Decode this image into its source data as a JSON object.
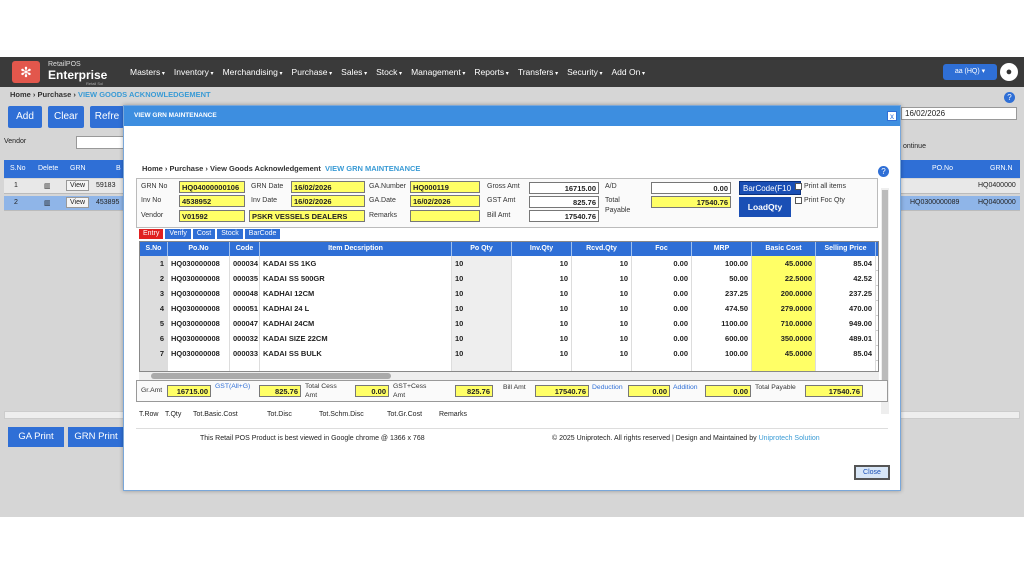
{
  "app": {
    "brand_small": "RetailPOS",
    "brand_big": "Enterprise",
    "brand_sub": "Retail Sol",
    "menu": [
      "Masters",
      "Inventory",
      "Merchandising",
      "Purchase",
      "Sales",
      "Stock",
      "Management",
      "Reports",
      "Transfers",
      "Security",
      "Add On"
    ],
    "user": "aa (HQ)"
  },
  "breadcrumb": {
    "home": "Home",
    "purchase": "Purchase",
    "current": "VIEW GOODS ACKNOWLEDGEMENT"
  },
  "bg": {
    "buttons": [
      "Add",
      "Clear",
      "Refre"
    ],
    "date": "16/02/2026",
    "vendor_label": "Vendor",
    "continue": "ontinue",
    "headers": [
      "S.No",
      "Delete",
      "GRN",
      "B",
      "PO.No",
      "GRN.N"
    ],
    "rows": [
      {
        "sno": "1",
        "view": "View",
        "num": "59183",
        "po": "",
        "grn": "HQ0400000"
      },
      {
        "sno": "2",
        "view": "View",
        "num": "453895",
        "po": "HQ0300000089",
        "grn": "HQ0400000"
      }
    ],
    "print_buttons": [
      "GA Print",
      "GRN Print"
    ]
  },
  "modal": {
    "title": "VIEW GRN MAINTENANCE",
    "close_x": "x",
    "crumb": {
      "home": "Home",
      "purchase": "Purchase",
      "mid": "View Goods Acknowledgement",
      "current": "VIEW GRN MAINTENANCE"
    },
    "form": {
      "grn_no_label": "GRN No",
      "grn_no": "HQ04000000106",
      "inv_no_label": "Inv No",
      "inv_no": "4538952",
      "vendor_label": "Vendor",
      "vendor": "V01592",
      "grn_date_label": "GRN Date",
      "grn_date": "16/02/2026",
      "inv_date_label": "Inv Date",
      "inv_date": "16/02/2026",
      "vendor_name": "PSKR VESSELS DEALERS",
      "ga_number_label": "GA.Number",
      "ga_number": "HQ000119",
      "ga_date_label": "GA.Date",
      "ga_date": "16/02/2026",
      "remarks_label": "Remarks",
      "remarks": "",
      "gross_amt_label": "Gross Amt",
      "gross_amt": "16715.00",
      "gst_amt_label": "GST Amt",
      "gst_amt": "825.76",
      "bill_amt_label": "Bill Amt",
      "bill_amt": "17540.76",
      "ad_label": "A/D",
      "ad": "0.00",
      "total_payable_label_1": "Total",
      "total_payable_label_2": "Payable",
      "total_payable": "17540.76",
      "barcode_btn": "BarCode(F10",
      "loadqty_btn": "LoadQty",
      "print_all": "Print all items",
      "print_foc": "Print Foc Qty"
    },
    "tabs": [
      {
        "label": "Entry",
        "color": "#e02020"
      },
      {
        "label": "Verify",
        "color": "#2f6fd6"
      },
      {
        "label": "Cost",
        "color": "#2f6fd6"
      },
      {
        "label": "Stock",
        "color": "#2f6fd6"
      },
      {
        "label": "BarCode",
        "color": "#2f6fd6"
      }
    ],
    "grid": {
      "headers": [
        "S.No",
        "Po.No",
        "Code",
        "Item Decsription",
        "Po Qty",
        "Inv.Qty",
        "Rcvd.Qty",
        "Foc",
        "MRP",
        "Basic Cost",
        "Selling Price"
      ],
      "rows": [
        {
          "sno": "1",
          "po": "HQ030000008",
          "code": "000034",
          "desc": "KADAI SS 1KG",
          "poqty": "10",
          "invqty": "10",
          "rcvd": "10",
          "foc": "0.00",
          "mrp": "100.00",
          "cost": "45.0000",
          "sp": "85.04"
        },
        {
          "sno": "2",
          "po": "HQ030000008",
          "code": "000035",
          "desc": "KADAI SS 500GR",
          "poqty": "10",
          "invqty": "10",
          "rcvd": "10",
          "foc": "0.00",
          "mrp": "50.00",
          "cost": "22.5000",
          "sp": "42.52"
        },
        {
          "sno": "3",
          "po": "HQ030000008",
          "code": "000048",
          "desc": "KADHAI 12CM",
          "poqty": "10",
          "invqty": "10",
          "rcvd": "10",
          "foc": "0.00",
          "mrp": "237.25",
          "cost": "200.0000",
          "sp": "237.25"
        },
        {
          "sno": "4",
          "po": "HQ030000008",
          "code": "000051",
          "desc": "KADHAI 24 L",
          "poqty": "10",
          "invqty": "10",
          "rcvd": "10",
          "foc": "0.00",
          "mrp": "474.50",
          "cost": "279.0000",
          "sp": "470.00"
        },
        {
          "sno": "5",
          "po": "HQ030000008",
          "code": "000047",
          "desc": "KADHAI 24CM",
          "poqty": "10",
          "invqty": "10",
          "rcvd": "10",
          "foc": "0.00",
          "mrp": "1100.00",
          "cost": "710.0000",
          "sp": "949.00"
        },
        {
          "sno": "6",
          "po": "HQ030000008",
          "code": "000032",
          "desc": "KADAI SIZE 22CM",
          "poqty": "10",
          "invqty": "10",
          "rcvd": "10",
          "foc": "0.00",
          "mrp": "600.00",
          "cost": "350.0000",
          "sp": "489.01"
        },
        {
          "sno": "7",
          "po": "HQ030000008",
          "code": "000033",
          "desc": "KADAI SS BULK",
          "poqty": "10",
          "invqty": "10",
          "rcvd": "10",
          "foc": "0.00",
          "mrp": "100.00",
          "cost": "45.0000",
          "sp": "85.04"
        }
      ]
    },
    "totals": {
      "gr_amt_label": "Gr.Amt",
      "gr_amt": "16715.00",
      "gst_label": "GST(All+G)",
      "gst": "825.76",
      "cess_label_1": "Total Cess",
      "cess_label_2": "Amt",
      "cess": "0.00",
      "gst_cess_label_1": "GST+Cess",
      "gst_cess_label_2": "Amt",
      "gst_cess": "825.76",
      "bill_label": "Bill Amt",
      "bill": "17540.76",
      "deduction_label": "Deduction",
      "deduction": "0.00",
      "addition_label": "Addition",
      "addition": "0.00",
      "total_payable_label": "Total Payable",
      "total_payable": "17540.76"
    },
    "footer_cols": [
      "T.Row",
      "T.Qty",
      "Tot.Basic.Cost",
      "Tot.Disc",
      "Tot.Schm.Disc",
      "Tot.Gr.Cost",
      "Remarks"
    ],
    "footer_left": "This Retail POS Product is best viewed in Google chrome @ 1366 x 768",
    "footer_right": "© 2025 Uniprotech. All rights reserved | Design and Maintained by",
    "footer_link": "Uniprotech Solution",
    "close_btn": "Close"
  }
}
